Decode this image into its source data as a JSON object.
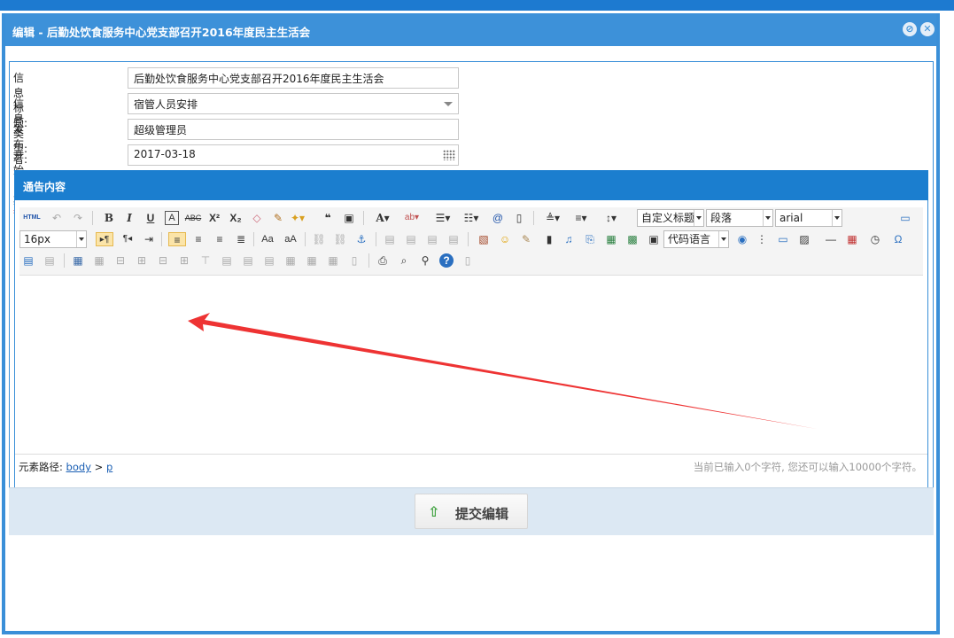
{
  "window": {
    "title": "编辑 - 后勤处饮食服务中心党支部召开2016年度民主生活会",
    "minimize_icon": "minimize-icon",
    "close_icon": "close-icon"
  },
  "form": {
    "title_label": "信息标题:",
    "title_value": "后勤处饮食服务中心党支部召开2016年度民主生活会",
    "type_label": "信息类型:",
    "type_value": "宿管人员安排",
    "publisher_label": "发布者:",
    "publisher_value": "超级管理员",
    "date_label": "开始日期",
    "date_required": "*:",
    "date_value": "2017-03-18"
  },
  "editor": {
    "section_title": "通告内容",
    "font_size": "16px",
    "custom_heading": "自定义标题",
    "paragraph": "段落",
    "font_family": "arial",
    "code_language": "代码语言",
    "html_label": "HTML",
    "path_label": "元素路径:",
    "path_body": "body",
    "path_sep": ">",
    "path_p": "p",
    "char_count": "当前已输入0个字符, 您还可以输入10000个字符。"
  },
  "footer": {
    "submit_label": "提交编辑",
    "submit_icon": "up-arrow-icon"
  },
  "colors": {
    "title_bar": "#3d91d9",
    "section_bar": "#1b7ecf",
    "annotation_arrow": "#ee3333"
  }
}
